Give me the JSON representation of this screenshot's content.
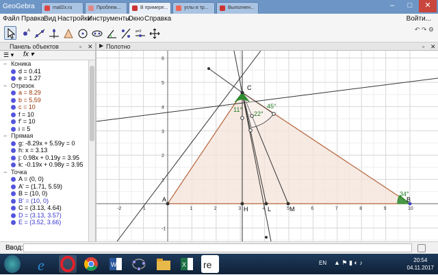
{
  "titlebar": {
    "app_name": "GeoGebra",
    "tabs": [
      "GeoGebra",
      "mail2x.ru",
      "Проблем...",
      "В примере...",
      "углы в тр...",
      "Выполнен..."
    ],
    "login": "Войти..."
  },
  "menu": [
    "Файл",
    "Правка",
    "Вид",
    "Настройки",
    "Инструменты",
    "Окно",
    "Справка"
  ],
  "algebra": {
    "title": "Панель объектов",
    "categories": [
      {
        "name": "Коника",
        "items": [
          {
            "text": "d = 0.41",
            "color": "#000000"
          },
          {
            "text": "e = 1.27",
            "color": "#000000"
          }
        ]
      },
      {
        "name": "Отрезок",
        "items": [
          {
            "text": "a = 8.29",
            "color": "#993300"
          },
          {
            "text": "b = 5.59",
            "color": "#993300"
          },
          {
            "text": "c = 10",
            "color": "#993300"
          },
          {
            "text": "f = 10",
            "color": "#000000"
          },
          {
            "text": "f' = 10",
            "color": "#000000"
          },
          {
            "text": "i = 5",
            "color": "#000000"
          }
        ]
      },
      {
        "name": "Прямая",
        "items": [
          {
            "text": "g: -8.29x + 5.59y = 0",
            "color": "#000000"
          },
          {
            "text": "h: x = 3.13",
            "color": "#000000"
          },
          {
            "text": "j: 0.98x + 0.19y = 3.95",
            "color": "#000000"
          },
          {
            "text": "k: -0.19x + 0.98y = 3.95",
            "color": "#000000"
          }
        ]
      },
      {
        "name": "Точка",
        "items": [
          {
            "text": "A = (0, 0)",
            "color": "#000000"
          },
          {
            "text": "A' = (1.71, 5.59)",
            "color": "#000000"
          },
          {
            "text": "B = (10, 0)",
            "color": "#000000"
          },
          {
            "text": "B' = (10, 0)",
            "color": "#3333cc"
          },
          {
            "text": "C = (3.13, 4.64)",
            "color": "#000000"
          },
          {
            "text": "D = (3.13, 3.57)",
            "color": "#3333cc"
          },
          {
            "text": "E = (3.52, 3.66)",
            "color": "#3333cc"
          }
        ]
      }
    ]
  },
  "graphics": {
    "title": "Полотно",
    "x_ticks": [
      "-2",
      "-1",
      "0",
      "1",
      "2",
      "3",
      "4",
      "5",
      "6",
      "7",
      "8",
      "9",
      "10"
    ],
    "y_ticks": [
      "6",
      "5",
      "4",
      "3",
      "2",
      "1",
      "-1"
    ],
    "points": {
      "A": "A",
      "B": "B",
      "C": "C",
      "H": "H",
      "L": "L",
      "M": "M"
    },
    "angles": {
      "a11": "11°",
      "a22": "22°",
      "a45": "45°",
      "a34": "34°"
    },
    "colors": {
      "triangle_fill": "#f4e0d6",
      "triangle_edge": "#b5643b",
      "angle_fill": "#2e8b2e",
      "point": "#4040c0"
    }
  },
  "inputbar": {
    "label": "Ввод:"
  },
  "taskbar": {
    "lang": "EN",
    "time": "20:54",
    "date": "04.11.2017"
  }
}
